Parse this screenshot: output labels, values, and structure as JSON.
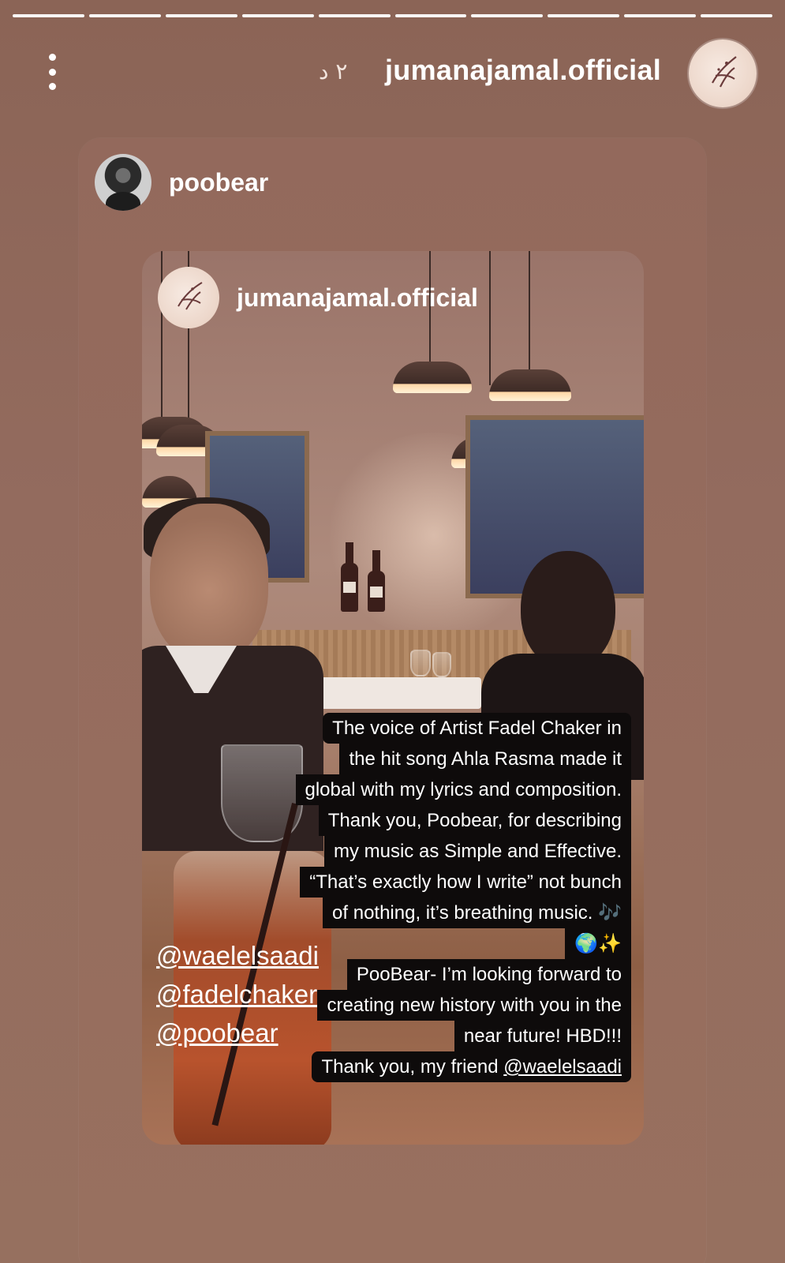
{
  "progress": {
    "segments": 10,
    "active_index": 0
  },
  "header": {
    "time_ago": "٢ د",
    "username": "jumanajamal.official",
    "more_icon": "more-vertical-icon"
  },
  "repost": {
    "username": "poobear",
    "inner": {
      "username": "jumanajamal.official"
    },
    "caption_lines": [
      "The voice of Artist Fadel Chaker in",
      "the hit song Ahla Rasma made it",
      "global with my lyrics and composition.",
      "Thank you, Poobear, for describing",
      "my music as Simple and Effective.",
      "“That’s exactly how I write” not bunch",
      "of nothing, it’s breathing music. 🎶",
      "🌍✨",
      "PooBear- I’m looking forward to",
      "creating new history with you in the",
      "near future! HBD!!!",
      "Thank you, my friend"
    ],
    "caption_mention": "@waelelsaadi",
    "tags": [
      "@waelelsaadi",
      "@fadelchaker",
      "@poobear"
    ]
  }
}
